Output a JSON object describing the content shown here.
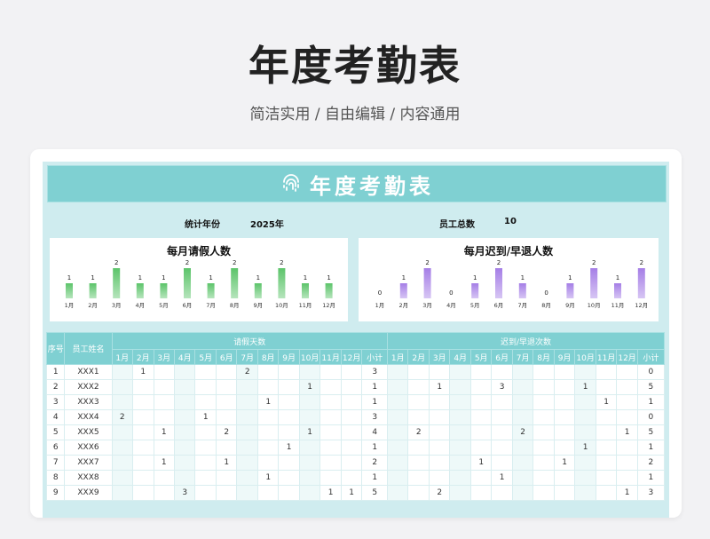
{
  "hero": {
    "title": "年度考勤表",
    "subtitle": "简洁实用 / 自由编辑 / 内容通用"
  },
  "sheet": {
    "banner_title": "年度考勤表",
    "year_label": "统计年份",
    "year_value": "2025年",
    "staff_label": "员工总数",
    "staff_value": "10"
  },
  "colors": {
    "accent": "#7fd0d2",
    "green_bar": "#5cc46a",
    "purple_bar": "#a57ee6"
  },
  "chart_data": [
    {
      "type": "bar",
      "title": "每月请假人数",
      "categories": [
        "1月",
        "2月",
        "3月",
        "4月",
        "5月",
        "6月",
        "7月",
        "8月",
        "9月",
        "10月",
        "11月",
        "12月"
      ],
      "values": [
        1,
        1,
        2,
        1,
        1,
        2,
        1,
        2,
        1,
        2,
        1,
        1
      ],
      "ylim": [
        0,
        2
      ]
    },
    {
      "type": "bar",
      "title": "每月迟到/早退人数",
      "categories": [
        "1月",
        "2月",
        "3月",
        "4月",
        "5月",
        "6月",
        "7月",
        "8月",
        "9月",
        "10月",
        "11月",
        "12月"
      ],
      "values": [
        0,
        1,
        2,
        0,
        1,
        2,
        1,
        0,
        1,
        2,
        1,
        2
      ],
      "ylim": [
        0,
        2
      ]
    }
  ],
  "table": {
    "h_seq": "序号",
    "h_name": "员工姓名",
    "h_leave": "请假天数",
    "h_late": "迟到/早退次数",
    "months": [
      "1月",
      "2月",
      "3月",
      "4月",
      "5月",
      "6月",
      "7月",
      "8月",
      "9月",
      "10月",
      "11月",
      "12月"
    ],
    "h_subtotal": "小计",
    "rows": [
      {
        "seq": "1",
        "name": "XXX1",
        "leave": [
          "",
          "1",
          "",
          "",
          "",
          "",
          "2",
          "",
          "",
          "",
          "",
          ""
        ],
        "leave_total": "3",
        "late": [
          "",
          "",
          "",
          "",
          "",
          "",
          "",
          "",
          "",
          "",
          "",
          ""
        ],
        "late_total": "0"
      },
      {
        "seq": "2",
        "name": "XXX2",
        "leave": [
          "",
          "",
          "",
          "",
          "",
          "",
          "",
          "",
          "",
          "1",
          "",
          ""
        ],
        "leave_total": "1",
        "late": [
          "",
          "",
          "1",
          "",
          "",
          "3",
          "",
          "",
          "",
          "1",
          "",
          ""
        ],
        "late_total": "5"
      },
      {
        "seq": "3",
        "name": "XXX3",
        "leave": [
          "",
          "",
          "",
          "",
          "",
          "",
          "",
          "1",
          "",
          "",
          "",
          ""
        ],
        "leave_total": "1",
        "late": [
          "",
          "",
          "",
          "",
          "",
          "",
          "",
          "",
          "",
          "",
          "1",
          ""
        ],
        "late_total": "1"
      },
      {
        "seq": "4",
        "name": "XXX4",
        "leave": [
          "2",
          "",
          "",
          "",
          "1",
          "",
          "",
          "",
          "",
          "",
          "",
          ""
        ],
        "leave_total": "3",
        "late": [
          "",
          "",
          "",
          "",
          "",
          "",
          "",
          "",
          "",
          "",
          "",
          ""
        ],
        "late_total": "0"
      },
      {
        "seq": "5",
        "name": "XXX5",
        "leave": [
          "",
          "",
          "1",
          "",
          "",
          "2",
          "",
          "",
          "",
          "1",
          "",
          ""
        ],
        "leave_total": "4",
        "late": [
          "",
          "2",
          "",
          "",
          "",
          "",
          "2",
          "",
          "",
          "",
          "",
          "1"
        ],
        "late_total": "5"
      },
      {
        "seq": "6",
        "name": "XXX6",
        "leave": [
          "",
          "",
          "",
          "",
          "",
          "",
          "",
          "",
          "1",
          "",
          "",
          ""
        ],
        "leave_total": "1",
        "late": [
          "",
          "",
          "",
          "",
          "",
          "",
          "",
          "",
          "",
          "1",
          "",
          ""
        ],
        "late_total": "1"
      },
      {
        "seq": "7",
        "name": "XXX7",
        "leave": [
          "",
          "",
          "1",
          "",
          "",
          "1",
          "",
          "",
          "",
          "",
          "",
          ""
        ],
        "leave_total": "2",
        "late": [
          "",
          "",
          "",
          "",
          "1",
          "",
          "",
          "",
          "1",
          "",
          "",
          ""
        ],
        "late_total": "2"
      },
      {
        "seq": "8",
        "name": "XXX8",
        "leave": [
          "",
          "",
          "",
          "",
          "",
          "",
          "",
          "1",
          "",
          "",
          "",
          ""
        ],
        "leave_total": "1",
        "late": [
          "",
          "",
          "",
          "",
          "",
          "1",
          "",
          "",
          "",
          "",
          "",
          ""
        ],
        "late_total": "1"
      },
      {
        "seq": "9",
        "name": "XXX9",
        "leave": [
          "",
          "",
          "",
          "3",
          "",
          "",
          "",
          "",
          "",
          "",
          "1",
          "1"
        ],
        "leave_total": "5",
        "late": [
          "",
          "",
          "2",
          "",
          "",
          "",
          "",
          "",
          "",
          "",
          "",
          "1"
        ],
        "late_total": "3"
      }
    ]
  }
}
